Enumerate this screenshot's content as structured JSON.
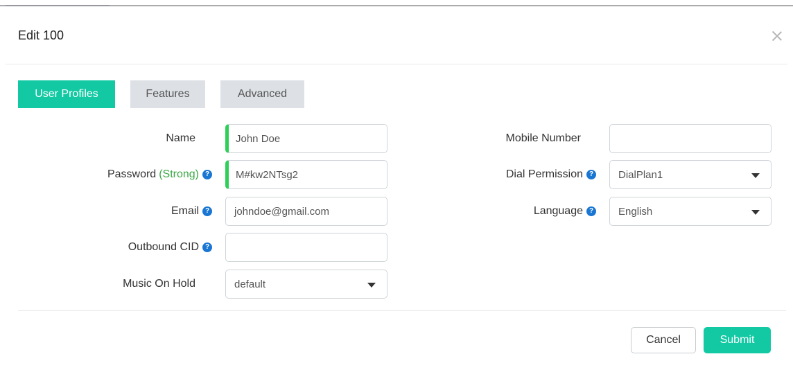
{
  "dialog": {
    "title": "Edit 100"
  },
  "tabs": [
    {
      "label": "User Profiles",
      "active": true
    },
    {
      "label": "Features",
      "active": false
    },
    {
      "label": "Advanced",
      "active": false
    }
  ],
  "form": {
    "name": {
      "label": "Name",
      "value": "John Doe"
    },
    "password": {
      "label": "Password",
      "strength": "(Strong)",
      "value": "M#kw2NTsg2"
    },
    "email": {
      "label": "Email",
      "value": "johndoe@gmail.com"
    },
    "outbound_cid": {
      "label": "Outbound CID",
      "value": ""
    },
    "music_on_hold": {
      "label": "Music On Hold",
      "value": "default"
    },
    "mobile_number": {
      "label": "Mobile Number",
      "value": ""
    },
    "dial_permission": {
      "label": "Dial Permission",
      "value": "DialPlan1"
    },
    "language": {
      "label": "Language",
      "value": "English"
    }
  },
  "buttons": {
    "cancel": "Cancel",
    "submit": "Submit"
  },
  "colors": {
    "accent": "#12c9a3",
    "tab_inactive": "#dde1e5",
    "strength_text": "#3aa845",
    "valid_indicator": "#2fcf5a",
    "help_icon": "#1976d2"
  },
  "icons": {
    "help": "question-circle-icon",
    "close": "close-icon",
    "dropdown": "caret-down-icon"
  }
}
